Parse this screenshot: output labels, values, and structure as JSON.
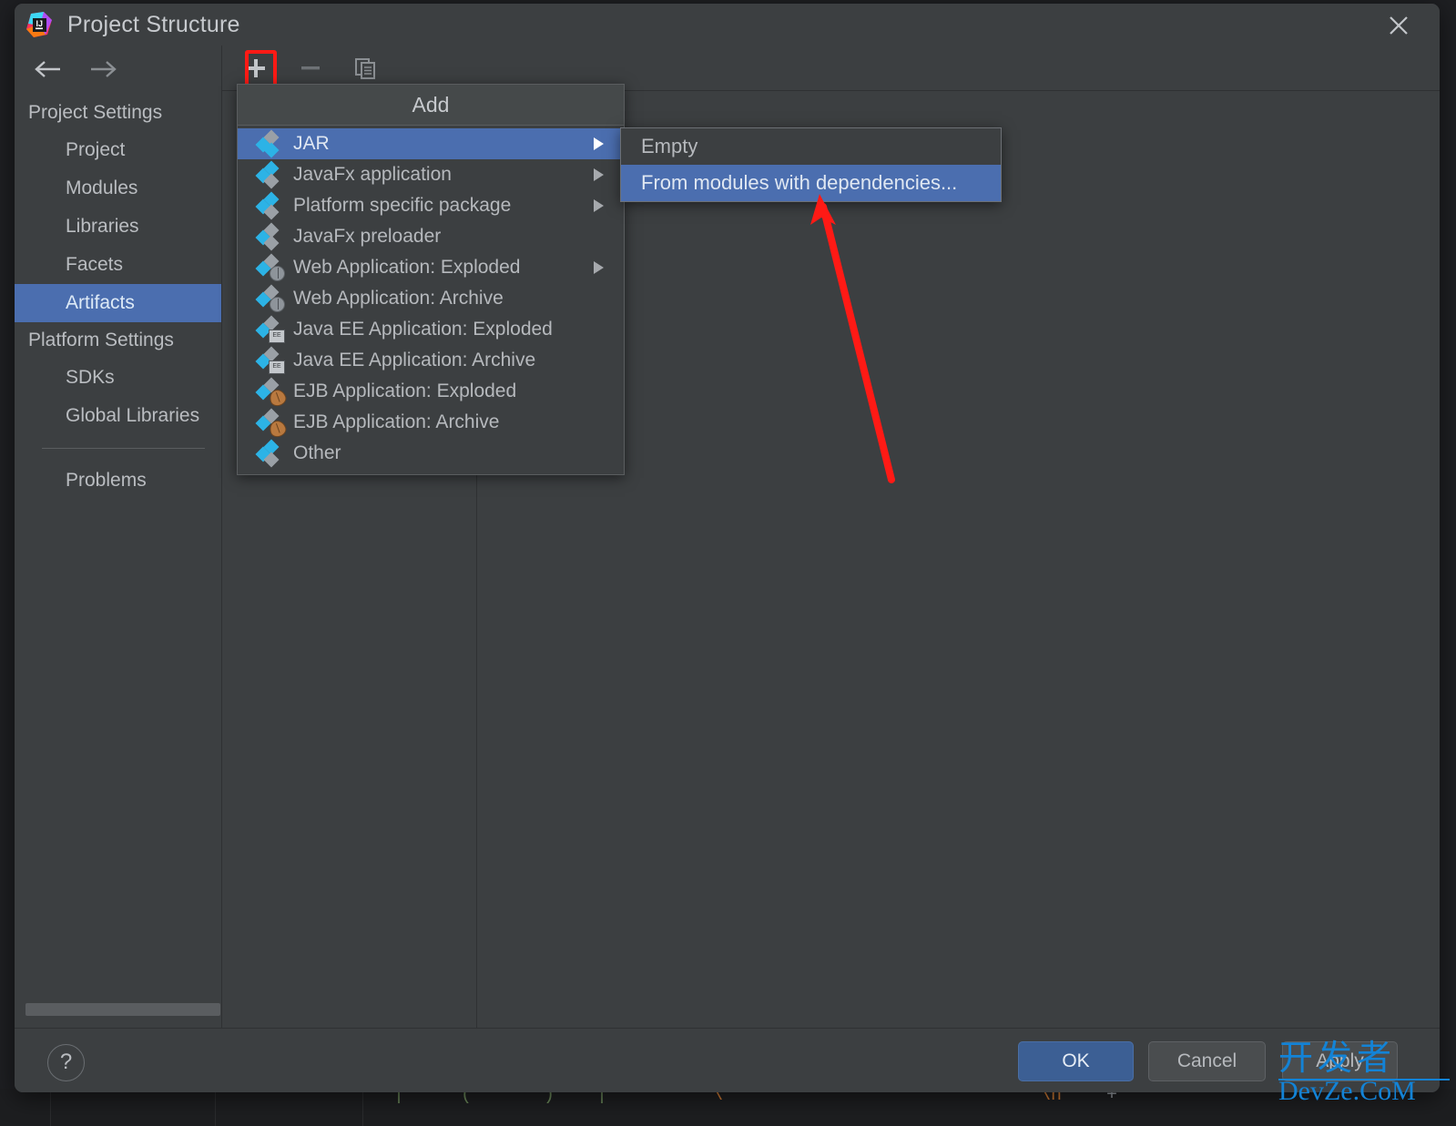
{
  "window": {
    "title": "Project Structure",
    "logo_icon": "intellij-idea-logo",
    "close_icon": "close-icon"
  },
  "nav": {
    "back_icon": "arrow-left-icon",
    "forward_icon": "arrow-right-icon"
  },
  "sidebar": {
    "groups": [
      {
        "label": "Project Settings",
        "items": [
          "Project",
          "Modules",
          "Libraries",
          "Facets",
          "Artifacts"
        ],
        "selected": "Artifacts"
      },
      {
        "label": "Platform Settings",
        "items": [
          "SDKs",
          "Global Libraries"
        ],
        "selected": null
      }
    ],
    "extra_items": [
      "Problems"
    ]
  },
  "toolbar": {
    "add_label": "+",
    "add_icon": "plus-icon",
    "remove_icon": "minus-icon",
    "copy_icon": "copy-icon",
    "highlight_color": "#ff1a15"
  },
  "add_menu": {
    "title": "Add",
    "items": [
      {
        "label": "JAR",
        "icon": "artifact-diamond-icon",
        "has_submenu": true,
        "selected": true
      },
      {
        "label": "JavaFx application",
        "icon": "artifact-diamond-icon",
        "has_submenu": true,
        "selected": false
      },
      {
        "label": "Platform specific package",
        "icon": "artifact-diamond-icon",
        "has_submenu": true,
        "selected": false
      },
      {
        "label": "JavaFx preloader",
        "icon": "artifact-diamond-icon",
        "has_submenu": false,
        "selected": false
      },
      {
        "label": "Web Application: Exploded",
        "icon": "artifact-web-icon",
        "has_submenu": true,
        "selected": false
      },
      {
        "label": "Web Application: Archive",
        "icon": "artifact-web-icon",
        "has_submenu": false,
        "selected": false
      },
      {
        "label": "Java EE Application: Exploded",
        "icon": "artifact-javaee-icon",
        "has_submenu": false,
        "selected": false
      },
      {
        "label": "Java EE Application: Archive",
        "icon": "artifact-javaee-icon",
        "has_submenu": false,
        "selected": false
      },
      {
        "label": "EJB Application: Exploded",
        "icon": "artifact-ejb-icon",
        "has_submenu": false,
        "selected": false
      },
      {
        "label": "EJB Application: Archive",
        "icon": "artifact-ejb-icon",
        "has_submenu": false,
        "selected": false
      },
      {
        "label": "Other",
        "icon": "artifact-diamond-icon",
        "has_submenu": false,
        "selected": false
      }
    ]
  },
  "submenu": {
    "items": [
      {
        "label": "Empty",
        "selected": false
      },
      {
        "label": "From modules with dependencies...",
        "selected": true
      }
    ]
  },
  "annotation": {
    "arrow_color": "#ff1a15",
    "points_to": "From modules with dependencies..."
  },
  "footer": {
    "help_label": "?",
    "ok_label": "OK",
    "cancel_label": "Cancel",
    "apply_label": "Apply"
  },
  "watermark": {
    "line1": "开发者",
    "line2": "DevZe.CoM",
    "color": "#1383d6"
  },
  "colors": {
    "dialog_bg": "#3c3f41",
    "selection_blue": "#4b6eaf",
    "text": "#b6b9bd",
    "icon_cyan": "#2cb3e6",
    "icon_gray": "#9aa0a6"
  }
}
